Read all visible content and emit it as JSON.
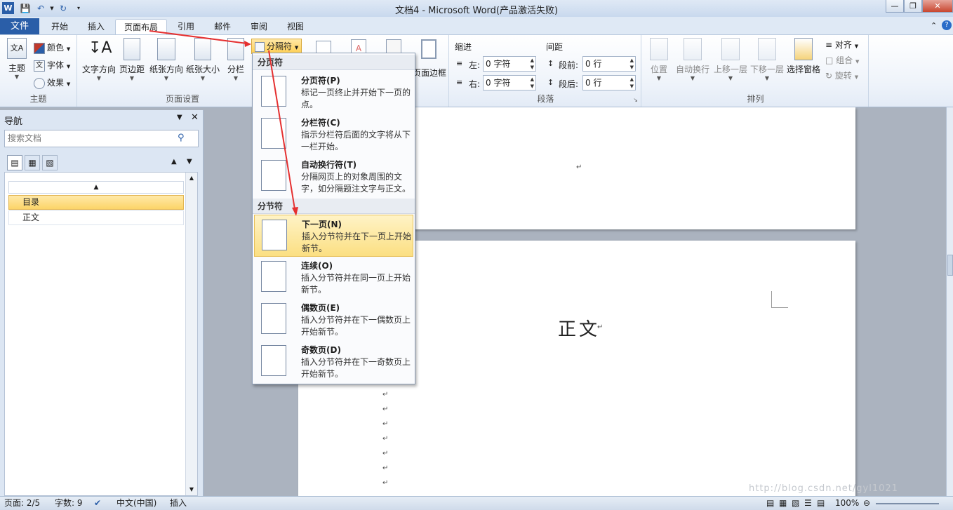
{
  "title": "文档4 - Microsoft Word(产品激活失败)",
  "quick_access": {
    "app_icon": "W"
  },
  "tabs": {
    "file": "文件",
    "items": [
      "开始",
      "插入",
      "页面布局",
      "引用",
      "邮件",
      "审阅",
      "视图"
    ],
    "active": "页面布局"
  },
  "ribbon": {
    "theme": {
      "theme_btn": "主题",
      "colors": "颜色",
      "fonts": "字体",
      "effects": "效果",
      "label": "主题"
    },
    "pagesetup": {
      "text_direction": "文字方向",
      "margins": "页边距",
      "orientation": "纸张方向",
      "size": "纸张大小",
      "columns": "分栏",
      "breaks": "分隔符",
      "label": "页面设置"
    },
    "background": {
      "page_borders": "页面边框"
    },
    "paragraph": {
      "indent": "缩进",
      "spacing": "间距",
      "left_label": "左:",
      "left_value": "0 字符",
      "right_label": "右:",
      "right_value": "0 字符",
      "before_label": "段前:",
      "before_value": "0 行",
      "after_label": "段后:",
      "after_value": "0 行",
      "label": "段落"
    },
    "arrange": {
      "position": "位置",
      "wrap": "自动换行",
      "bring_forward": "上移一层",
      "send_backward": "下移一层",
      "selection_pane": "选择窗格",
      "align": "对齐",
      "group": "组合",
      "rotate": "旋转",
      "label": "排列"
    }
  },
  "nav": {
    "title": "导航",
    "search_placeholder": "搜索文档",
    "items": [
      "目录",
      "正文"
    ]
  },
  "breaks_menu": {
    "page_breaks_header": "分页符",
    "section_breaks_header": "分节符",
    "items": [
      {
        "title": "分页符(P)",
        "desc": "标记一页终止并开始下一页的点。"
      },
      {
        "title": "分栏符(C)",
        "desc": "指示分栏符后面的文字将从下一栏开始。"
      },
      {
        "title": "自动换行符(T)",
        "desc": "分隔网页上的对象周围的文字，如分隔题注文字与正文。"
      },
      {
        "title": "下一页(N)",
        "desc": "插入分节符并在下一页上开始新节。"
      },
      {
        "title": "连续(O)",
        "desc": "插入分节符并在同一页上开始新节。"
      },
      {
        "title": "偶数页(E)",
        "desc": "插入分节符并在下一偶数页上开始新节。"
      },
      {
        "title": "奇数页(D)",
        "desc": "插入分节符并在下一奇数页上开始新节。"
      }
    ]
  },
  "document": {
    "heading": "正文",
    "para_mark": "↵"
  },
  "status": {
    "page": "页面: 2/5",
    "words": "字数: 9",
    "lang": "中文(中国)",
    "mode": "插入",
    "zoom": "100%"
  },
  "watermark": "http://blog.csdn.net/gyl1021"
}
